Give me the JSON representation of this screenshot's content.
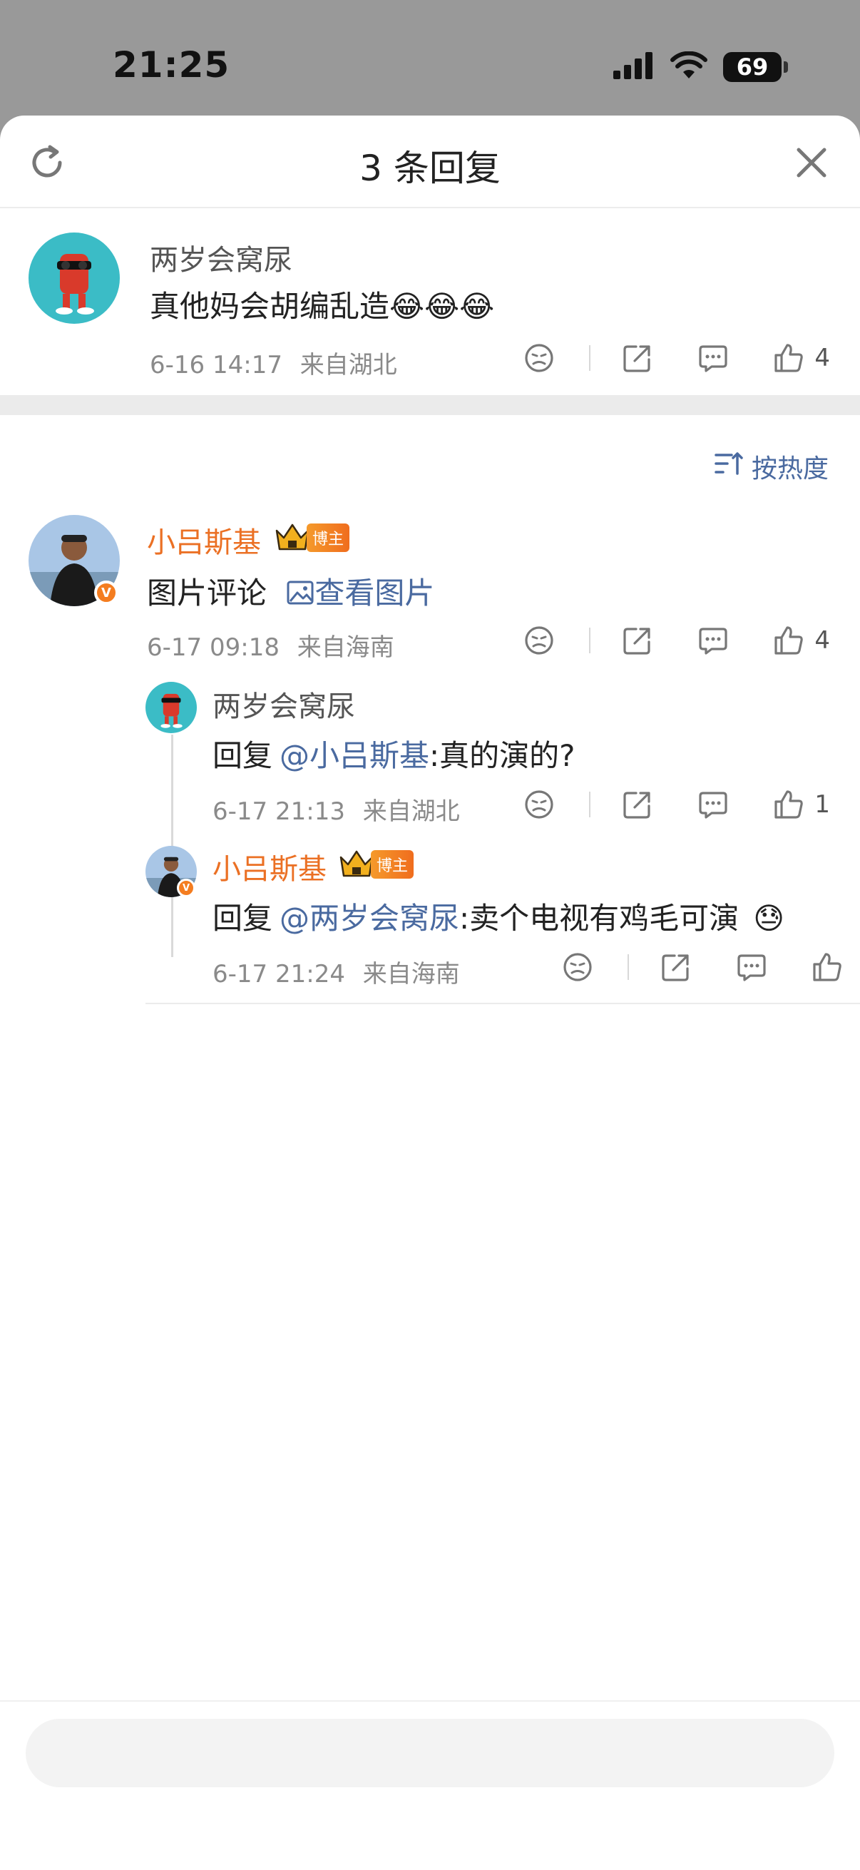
{
  "status": {
    "time": "21:25",
    "battery": "69"
  },
  "header": {
    "title": "3 条回复"
  },
  "root": {
    "author": "两岁会窝尿",
    "text": "真他妈会胡编乱造",
    "emojis": "😂😂😂",
    "time": "6-16 14:17",
    "location": "来自湖北",
    "likes": "4"
  },
  "sort": {
    "label": "按热度"
  },
  "comment": {
    "author": "小吕斯基",
    "badge": "博主",
    "text": "图片评论",
    "link": "查看图片",
    "time": "6-17 09:18",
    "location": "来自海南",
    "likes": "4"
  },
  "replies": [
    {
      "author": "两岁会窝尿",
      "prefix": "回复",
      "mention": "@小吕斯基",
      "text": ":真的演的?",
      "time": "6-17 21:13",
      "location": "来自湖北",
      "likes": "1"
    },
    {
      "author": "小吕斯基",
      "badge": "博主",
      "prefix": "回复",
      "mention": "@两岁会窝尿",
      "text": ":卖个电视有鸡毛可演",
      "emoji": "😓",
      "time": "6-17 21:24",
      "location": "来自海南",
      "likes": ""
    }
  ],
  "input": {
    "placeholder": ""
  },
  "colors": {
    "accent": "#eb7024",
    "link": "#4a6aa0",
    "divider": "#ebebeb"
  },
  "icons": [
    "refresh-icon",
    "close-icon",
    "dislike-icon",
    "share-icon",
    "comment-icon",
    "like-icon",
    "sort-icon",
    "image-icon",
    "crown-icon",
    "signal-icon",
    "wifi-icon",
    "battery-icon"
  ]
}
